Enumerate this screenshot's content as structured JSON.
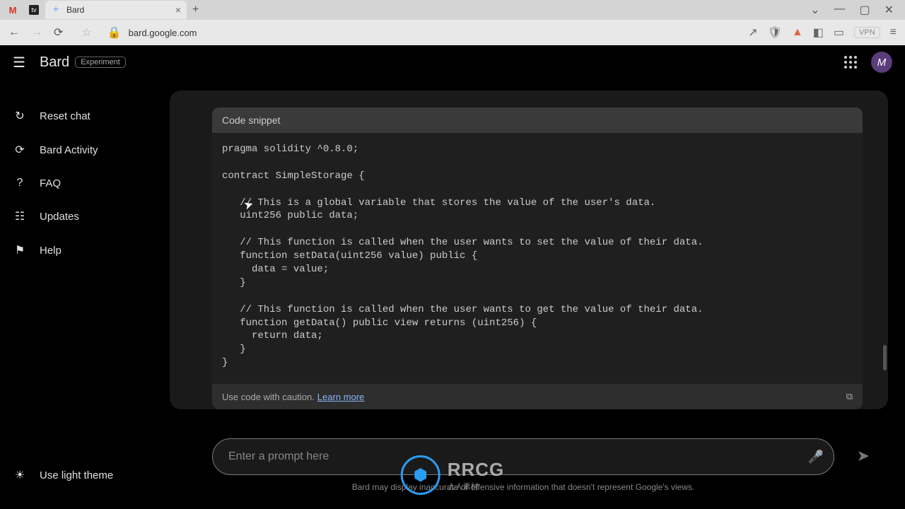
{
  "browser": {
    "tab_title": "Bard",
    "address": "bard.google.com",
    "vpn_label": "VPN"
  },
  "header": {
    "brand": "Bard",
    "badge": "Experiment",
    "avatar_letter": "M"
  },
  "sidebar": {
    "items": [
      {
        "icon": "↻",
        "label": "Reset chat"
      },
      {
        "icon": "⟳",
        "label": "Bard Activity"
      },
      {
        "icon": "?",
        "label": "FAQ"
      },
      {
        "icon": "☷",
        "label": "Updates"
      },
      {
        "icon": "⚑",
        "label": "Help"
      }
    ],
    "theme_icon": "☀",
    "theme_label": "Use light theme"
  },
  "code": {
    "header": "Code snippet",
    "body": "pragma solidity ^0.8.0;\n\ncontract SimpleStorage {\n\n   // This is a global variable that stores the value of the user's data.\n   uint256 public data;\n\n   // This function is called when the user wants to set the value of their data.\n   function setData(uint256 value) public {\n     data = value;\n   }\n\n   // This function is called when the user wants to get the value of their data.\n   function getData() public view returns (uint256) {\n     return data;\n   }\n}",
    "caution": "Use code with caution.",
    "learn_more": "Learn more"
  },
  "prompt": {
    "placeholder": "Enter a prompt here"
  },
  "disclaimer": "Bard may display inaccurate or offensive information that doesn't represent Google's views.",
  "watermark": {
    "circle": "⬢",
    "text": "RRCG",
    "sub": "人人素材"
  }
}
